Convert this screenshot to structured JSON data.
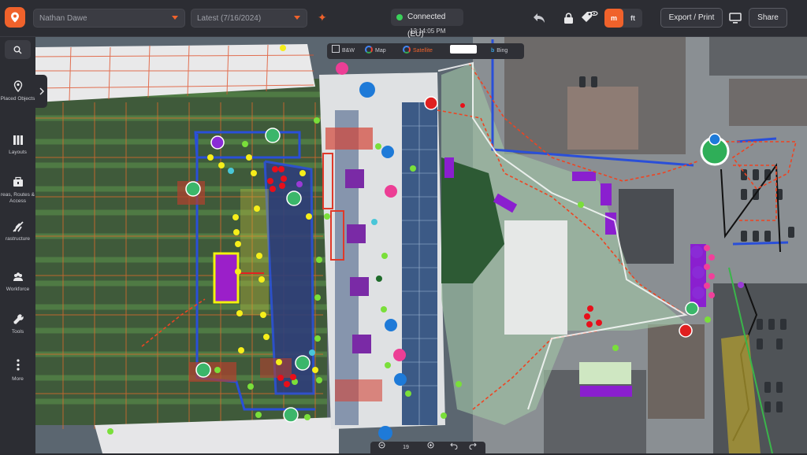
{
  "topbar": {
    "user_select": "Nathan Dawe",
    "version_select": "Latest (7/16/2024)",
    "connection_status": "Connected (EU)",
    "clock": "12:14:05 PM",
    "mode_m_label": "m",
    "mode_ft_label": "ft",
    "export_label": "Export / Print",
    "share_label": "Share"
  },
  "sidebar": {
    "items": [
      {
        "label": "Placed Objects",
        "icon": "map-pin-icon"
      },
      {
        "label": "Layouts",
        "icon": "layouts-icon"
      },
      {
        "label": "reas, Routes & Access",
        "icon": "routes-icon"
      },
      {
        "label": "rastructure",
        "icon": "infrastructure-icon"
      },
      {
        "label": "Workforce",
        "icon": "workforce-icon"
      },
      {
        "label": "Tools",
        "icon": "tools-icon"
      },
      {
        "label": "More",
        "icon": "more-icon"
      }
    ]
  },
  "layers": {
    "bw": "B&W",
    "google_map": "Map",
    "google_satellite": "Satellite",
    "bing": "Bing"
  },
  "zoom": {
    "level": "19"
  },
  "colors": {
    "accent": "#f0622b",
    "connected": "#3ad15a",
    "topbar_bg": "#2c2d33"
  }
}
